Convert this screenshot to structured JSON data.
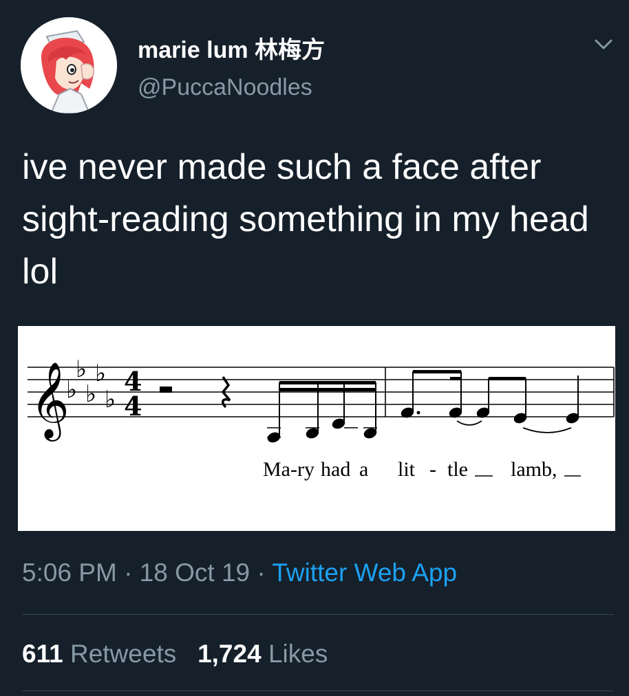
{
  "tweet": {
    "author": {
      "name": "marie lum 林梅方",
      "handle": "@PuccaNoodles"
    },
    "text": "ive never made such a face after sight-reading something in my head lol",
    "sheet_music": {
      "lyrics": [
        "Ma-ry",
        "had",
        "a",
        "lit",
        "-",
        "tle",
        "lamb,"
      ]
    },
    "time": "5:06 PM",
    "date": "18 Oct 19",
    "separator": "·",
    "source": "Twitter Web App",
    "retweets": {
      "count": "611",
      "label": "Retweets"
    },
    "likes": {
      "count": "1,724",
      "label": "Likes"
    }
  },
  "icons": {
    "avatar": "cartoon-avatar",
    "menu": "chevron-down-icon"
  },
  "colors": {
    "background": "#15202b",
    "secondary_text": "#8899a6",
    "link": "#1da1f2"
  }
}
